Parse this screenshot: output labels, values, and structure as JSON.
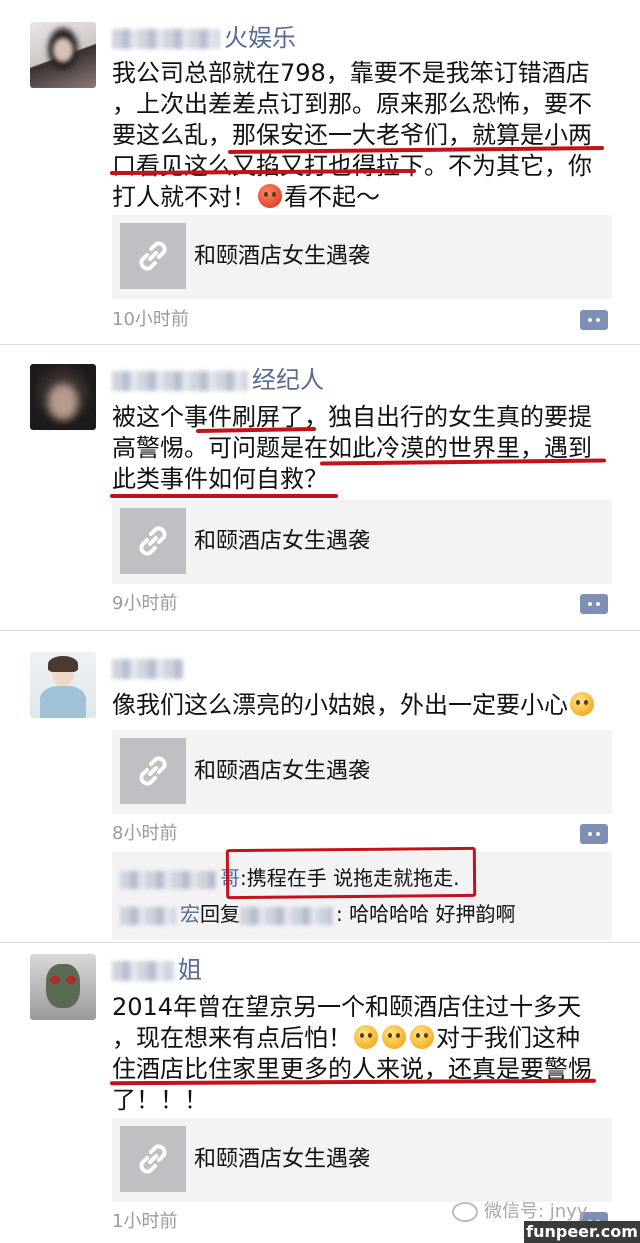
{
  "posts": [
    {
      "name_suffix": "火娱乐",
      "lines": [
        "我公司总部就在798，靠要不是我笨订错酒店",
        "，上次出差差点订到那。原来那么恐怖，要不",
        "要这么乱，那保安还一大老爷们，就算是小两",
        "口看见这么又掐又打也得拉下。不为其它，你"
      ],
      "last_line_before_emoji": "打人就不对！",
      "last_line_after_emoji": "看不起～",
      "link_title": "和颐酒店女生遇袭",
      "time": "10小时前"
    },
    {
      "name_suffix": "经纪人",
      "lines": [
        "被这个事件刷屏了，独自出行的女生真的要提",
        "高警惕。可问题是在如此冷漠的世界里，遇到",
        "此类事件如何自救？"
      ],
      "link_title": "和颐酒店女生遇袭",
      "time": "9小时前"
    },
    {
      "name_suffix": "",
      "line_before_emoji": "像我们这么漂亮的小姑娘，外出一定要小心",
      "link_title": "和颐酒店女生遇袭",
      "time": "8小时前",
      "replies": [
        {
          "name_suffix": "哥",
          "sep": ":",
          "text": "携程在手 说拖走就拖走."
        },
        {
          "name_suffix": "宏",
          "reply_word": "回复",
          "text": ": 哈哈哈哈 好押韵啊"
        }
      ]
    },
    {
      "name_suffix": "姐",
      "line1": "2014年曾在望京另一个和颐酒店住过十多天",
      "line2_before": "，现在想来有点后怕！",
      "line2_after": "对于我们这种",
      "line3": "住酒店比住家里更多的人来说，还真是要警惕",
      "line4": "了！！！",
      "link_title": "和颐酒店女生遇袭",
      "time": "1小时前"
    }
  ],
  "watermark": {
    "wechat": "微信号: jnyy",
    "site": "funpeer.com"
  },
  "icons": {
    "link": "link-icon",
    "comment": "comment-icon",
    "emoji": "emoji-icon"
  },
  "colors": {
    "name": "#576b95",
    "annotation": "#c4121a",
    "card_bg": "#f3f3f5"
  }
}
